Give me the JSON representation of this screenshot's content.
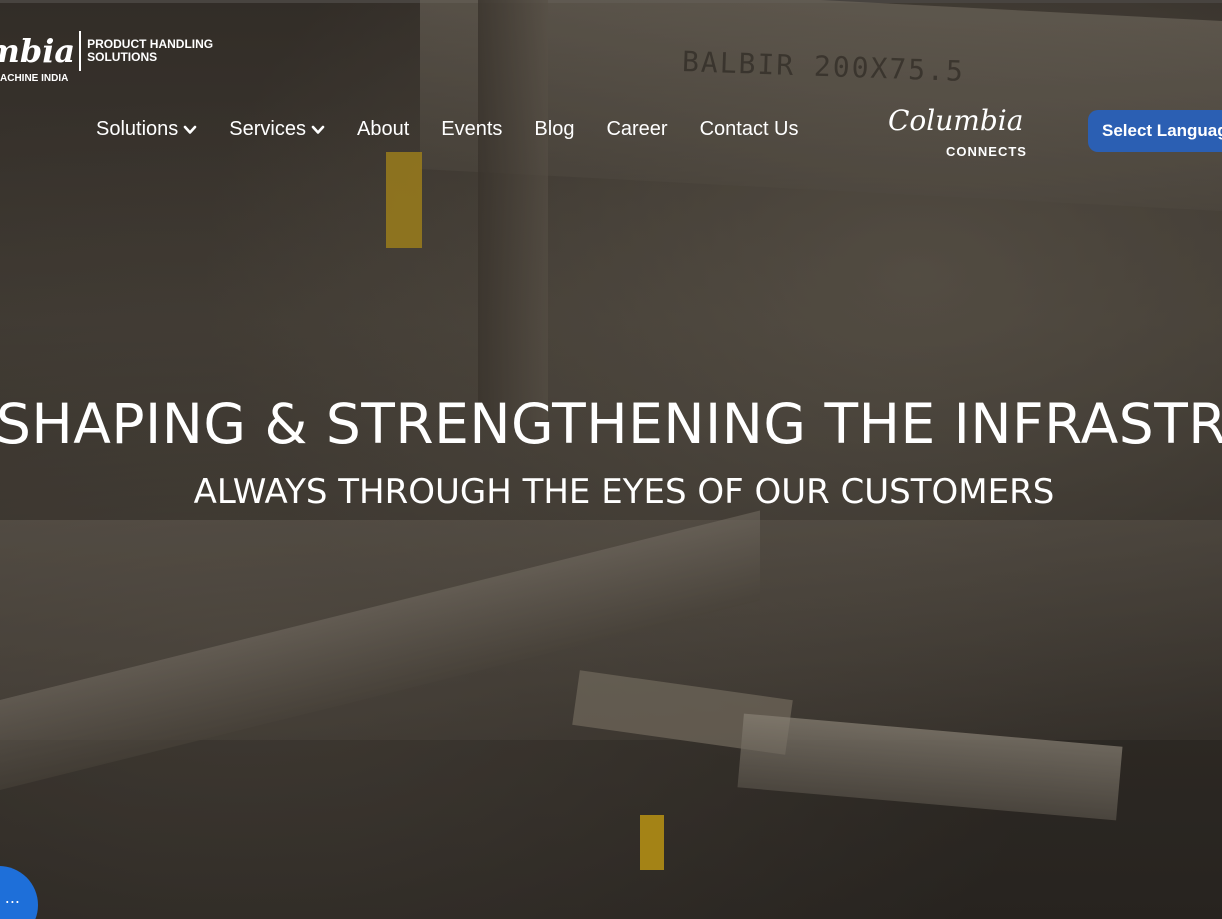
{
  "brand": {
    "logo_script": "mbia",
    "logo_sub": "ACHINE INDIA",
    "tagline_line1": "PRODUCT HANDLING",
    "tagline_line2": "SOLUTIONS"
  },
  "nav": {
    "items": [
      {
        "label": "Solutions",
        "has_dropdown": true
      },
      {
        "label": "Services",
        "has_dropdown": true
      },
      {
        "label": "About",
        "has_dropdown": false
      },
      {
        "label": "Events",
        "has_dropdown": false
      },
      {
        "label": "Blog",
        "has_dropdown": false
      },
      {
        "label": "Career",
        "has_dropdown": false
      },
      {
        "label": "Contact Us",
        "has_dropdown": false
      }
    ]
  },
  "connects": {
    "script": "Columbia",
    "word": "CONNECTS"
  },
  "language": {
    "label": "Select Language",
    "color": "#2b5fb3"
  },
  "hero": {
    "headline": "SHAPING & STRENGTHENING THE INFRASTRUCTURE",
    "subheadline": "ALWAYS THROUGH THE EYES OF OUR CUSTOMERS",
    "background_text": "BALBIR 200X75.5"
  },
  "chat": {
    "label": "...",
    "icon": "chat-icon",
    "color": "#1e6fd9"
  }
}
